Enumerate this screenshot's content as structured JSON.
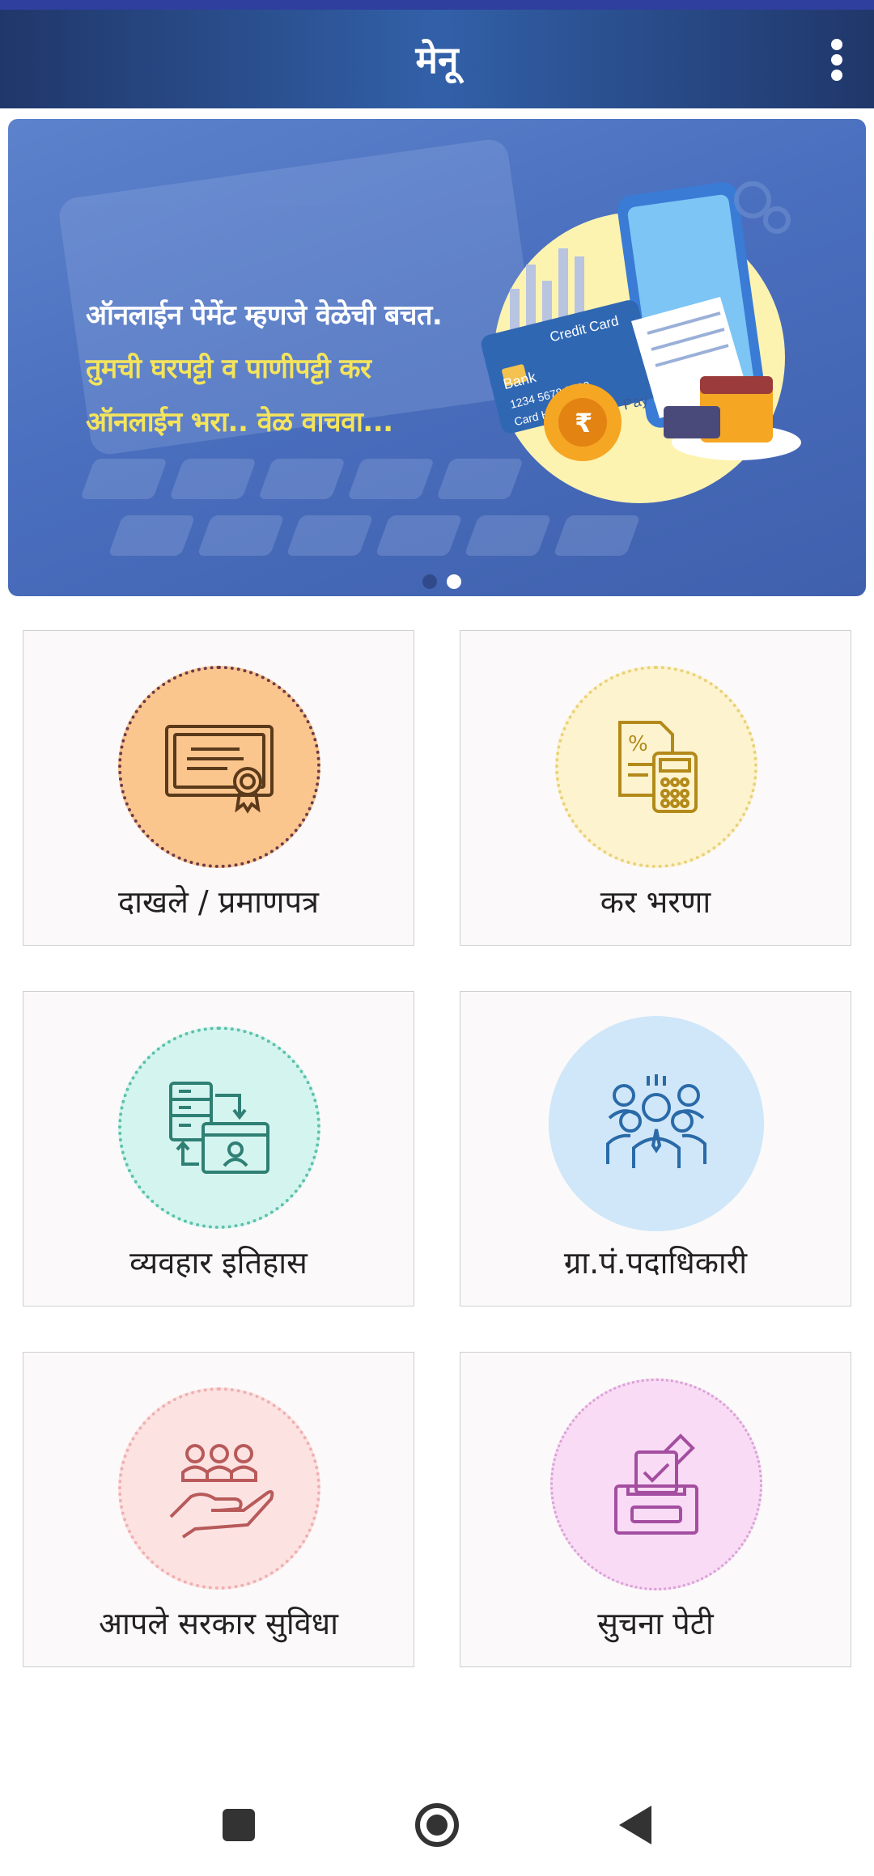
{
  "app_bar": {
    "title": "मेनू",
    "menu_icon": "more-vert-icon"
  },
  "banner": {
    "line1": "ऑनलाईन पेमेंट म्हणजे वेळेची बचत.",
    "line2": "तुमची घरपट्टी व पाणीपट्टी कर",
    "line3": "ऑनलाईन भरा.. वेळ वाचवा...",
    "card_text": [
      "Bank",
      "Credit Card",
      "1234 5678 9000",
      "Card Holder",
      "Pay"
    ],
    "slide_count": 2,
    "active_slide": 2
  },
  "menu": {
    "items": [
      {
        "label": "दाखले / प्रमाणपत्र",
        "icon": "certificate-icon",
        "color": "#fbc58e"
      },
      {
        "label": "कर भरणा",
        "icon": "tax-calculator-icon",
        "color": "#fdf3cf"
      },
      {
        "label": "व्यवहार इतिहास",
        "icon": "transaction-history-icon",
        "color": "#d4f4ef"
      },
      {
        "label": "ग्रा.पं.पदाधिकारी",
        "icon": "officials-group-icon",
        "color": "#cfe7f8"
      },
      {
        "label": "आपले सरकार सुविधा",
        "icon": "citizen-services-icon",
        "color": "#fde2e2"
      },
      {
        "label": "सुचना पेटी",
        "icon": "suggestion-box-icon",
        "color": "#f9dbf6"
      }
    ]
  },
  "nav_bar": {
    "icons": [
      "recents-icon",
      "home-icon",
      "back-icon"
    ]
  }
}
